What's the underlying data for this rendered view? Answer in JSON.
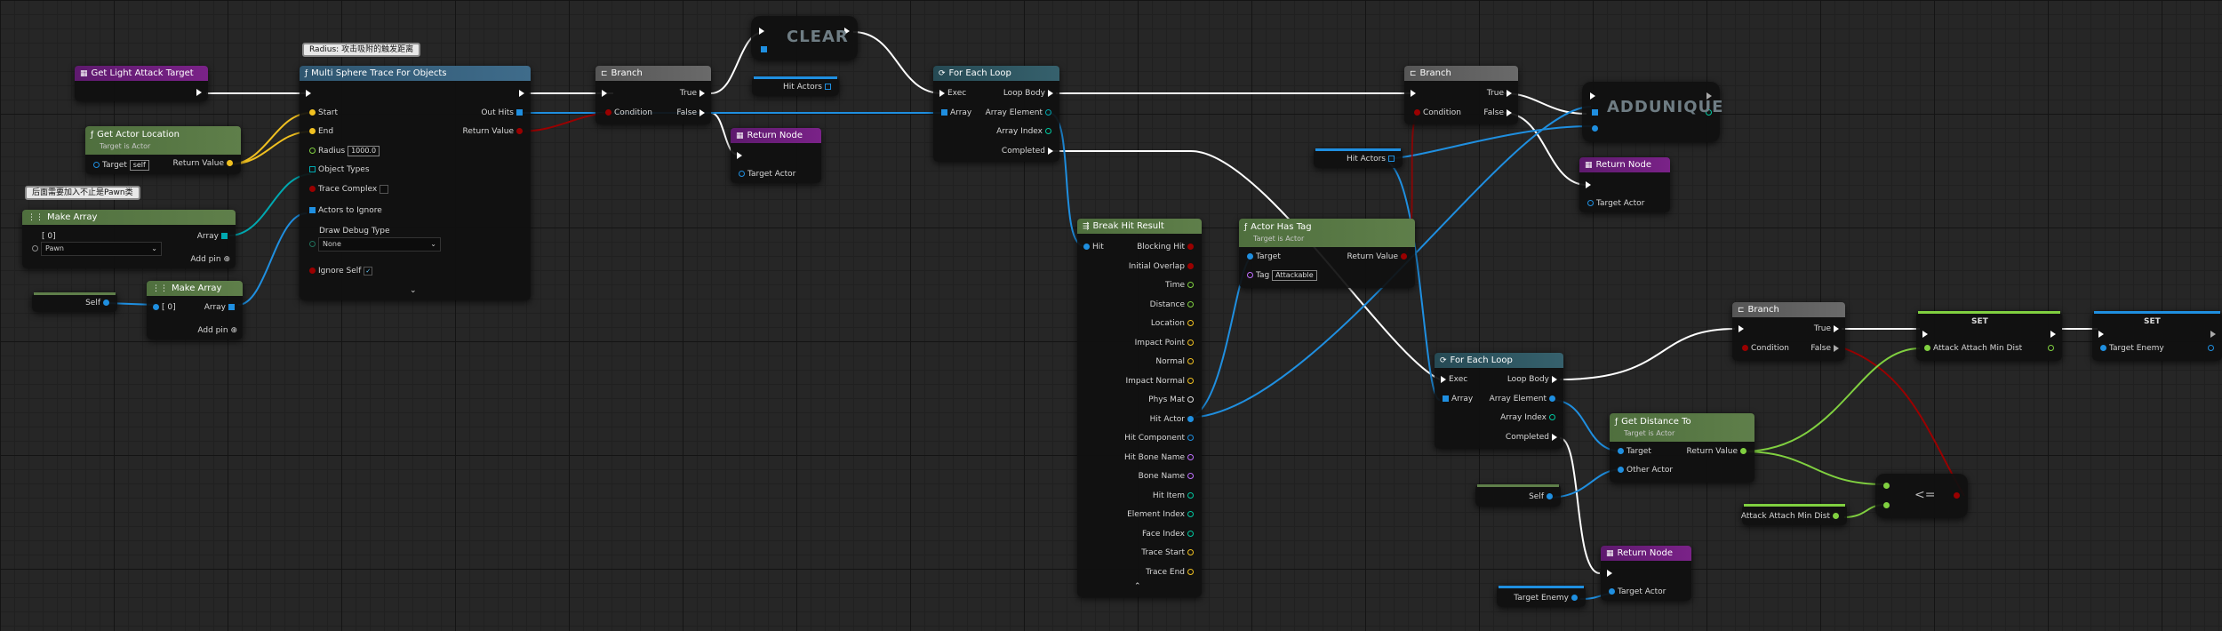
{
  "colors": {
    "exec": "#ffffff",
    "object": "#1f8fe0",
    "bool": "#9a0000",
    "float": "#80d040",
    "vector": "#f0c020",
    "struct": "#00a8b0",
    "name": "#c070ff"
  },
  "comments": {
    "radius": "Radius: 攻击吸附的触发距离",
    "pawn": "后面需要加入不止是Pawn类"
  },
  "nodes": {
    "get_light_attack_target": {
      "title": "Get Light Attack Target"
    },
    "get_actor_location": {
      "title": "Get Actor Location",
      "subtitle": "Target is Actor",
      "target": "Target",
      "target_value": "self",
      "return": "Return Value"
    },
    "make_array_1": {
      "title": "Make Array",
      "index": "[ 0]",
      "array": "Array",
      "pawn": "Pawn",
      "add_pin": "Add pin"
    },
    "self_1": {
      "label": "Self"
    },
    "make_array_2": {
      "title": "Make Array",
      "index": "[ 0]",
      "array": "Array",
      "add_pin": "Add pin"
    },
    "multi_sphere": {
      "title": "Multi Sphere Trace For Objects",
      "start": "Start",
      "end": "End",
      "radius": "Radius",
      "radius_value": "1000.0",
      "object_types": "Object Types",
      "trace_complex": "Trace Complex",
      "actors_to_ignore": "Actors to Ignore",
      "draw_debug": "Draw Debug Type",
      "draw_debug_value": "None",
      "ignore_self": "Ignore Self",
      "out_hits": "Out Hits",
      "return_value": "Return Value",
      "chevron": "⌄"
    },
    "branch_1": {
      "title": "Branch",
      "condition": "Condition",
      "true": "True",
      "false": "False"
    },
    "clear": {
      "title": "CLEAR"
    },
    "hit_actors_1": {
      "label": "Hit Actors"
    },
    "return_node_1": {
      "title": "Return Node",
      "target": "Target Actor"
    },
    "for_each_1": {
      "title": "For Each Loop",
      "exec": "Exec",
      "array": "Array",
      "loop_body": "Loop Body",
      "array_element": "Array Element",
      "array_index": "Array Index",
      "completed": "Completed"
    },
    "break_hit": {
      "title": "Break Hit Result",
      "hit": "Hit",
      "pins": [
        "Blocking Hit",
        "Initial Overlap",
        "Time",
        "Distance",
        "Location",
        "Impact Point",
        "Normal",
        "Impact Normal",
        "Phys Mat",
        "Hit Actor",
        "Hit Component",
        "Hit Bone Name",
        "Bone Name",
        "Hit Item",
        "Element Index",
        "Face Index",
        "Trace Start",
        "Trace End"
      ],
      "chevron": "⌃"
    },
    "actor_has_tag": {
      "title": "Actor Has Tag",
      "subtitle": "Target is Actor",
      "target": "Target",
      "tag": "Tag",
      "tag_value": "Attackable",
      "return": "Return Value"
    },
    "branch_2": {
      "title": "Branch",
      "condition": "Condition",
      "true": "True",
      "false": "False"
    },
    "addunique": {
      "title": "ADDUNIQUE"
    },
    "hit_actors_2": {
      "label": "Hit Actors"
    },
    "return_node_2": {
      "title": "Return Node",
      "target": "Target Actor"
    },
    "for_each_2": {
      "title": "For Each Loop",
      "exec": "Exec",
      "array": "Array",
      "loop_body": "Loop Body",
      "array_element": "Array Element",
      "array_index": "Array Index",
      "completed": "Completed"
    },
    "get_distance": {
      "title": "Get Distance To",
      "subtitle": "Target is Actor",
      "target": "Target",
      "other": "Other Actor",
      "return": "Return Value"
    },
    "self_2": {
      "label": "Self"
    },
    "return_node_3": {
      "title": "Return Node",
      "target": "Target Actor"
    },
    "target_enemy_get": {
      "label": "Target Enemy"
    },
    "branch_3": {
      "title": "Branch",
      "condition": "Condition",
      "true": "True",
      "false": "False"
    },
    "set_1": {
      "title": "SET",
      "pin": "Attack Attach Min Dist"
    },
    "set_2": {
      "title": "SET",
      "pin": "Target Enemy"
    },
    "compare": {
      "symbol": "<="
    },
    "attack_min_get": {
      "label": "Attack Attach Min Dist"
    }
  }
}
